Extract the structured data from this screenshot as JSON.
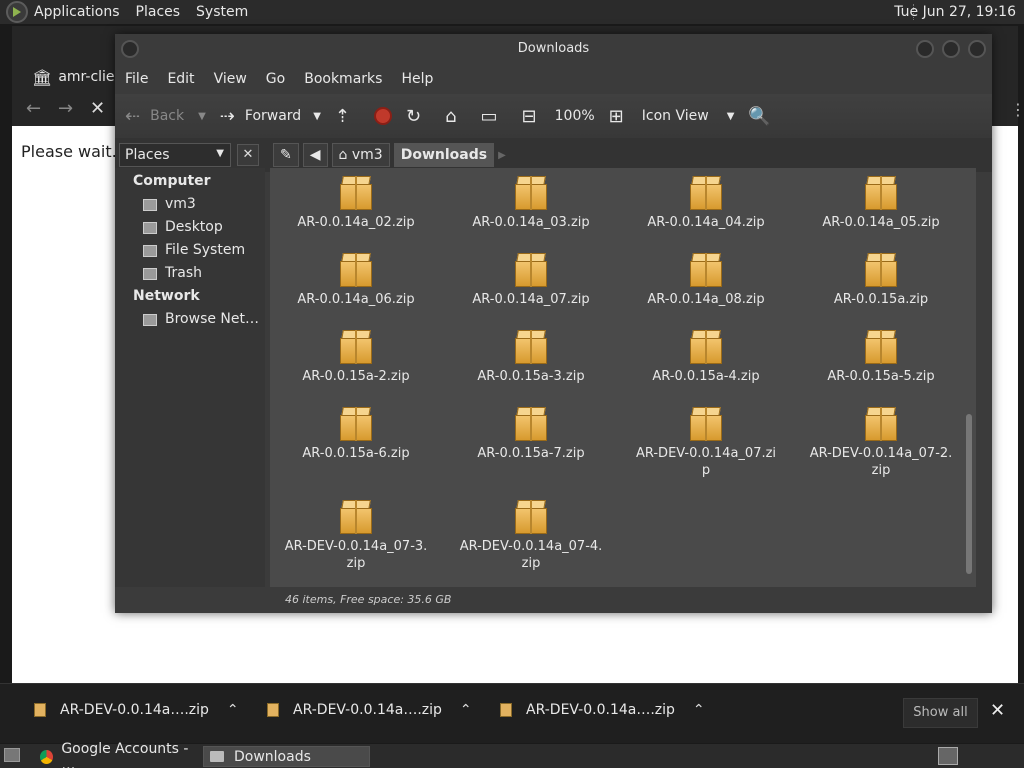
{
  "top_panel": {
    "menus": [
      "Applications",
      "Places",
      "System"
    ],
    "clock": "Tue Jun 27, 19:16"
  },
  "browser": {
    "tab_label": "amr-clien",
    "page_text": "Please wait..."
  },
  "fm": {
    "title": "Downloads",
    "menu": [
      "File",
      "Edit",
      "View",
      "Go",
      "Bookmarks",
      "Help"
    ],
    "toolbar": {
      "back": "Back",
      "forward": "Forward",
      "zoom": "100%",
      "view_mode": "Icon View"
    },
    "locbar": {
      "places": "Places",
      "crumbs": [
        "vm3",
        "Downloads"
      ]
    },
    "sidebar": {
      "computer": "Computer",
      "computer_items": [
        "vm3",
        "Desktop",
        "File System",
        "Trash"
      ],
      "network": "Network",
      "network_items": [
        "Browse Net…"
      ]
    },
    "files": [
      "AR-0.0.14a_02.zip",
      "AR-0.0.14a_03.zip",
      "AR-0.0.14a_04.zip",
      "AR-0.0.14a_05.zip",
      "AR-0.0.14a_06.zip",
      "AR-0.0.14a_07.zip",
      "AR-0.0.14a_08.zip",
      "AR-0.0.15a.zip",
      "AR-0.0.15a-2.zip",
      "AR-0.0.15a-3.zip",
      "AR-0.0.15a-4.zip",
      "AR-0.0.15a-5.zip",
      "AR-0.0.15a-6.zip",
      "AR-0.0.15a-7.zip",
      "AR-DEV-0.0.14a_07.zip",
      "AR-DEV-0.0.14a_07-2.zip",
      "AR-DEV-0.0.14a_07-3.zip",
      "AR-DEV-0.0.14a_07-4.zip"
    ],
    "status": "46 items, Free space: 35.6 GB"
  },
  "shelf": {
    "downloads": [
      "AR-DEV-0.0.14a….zip",
      "AR-DEV-0.0.14a….zip",
      "AR-DEV-0.0.14a….zip"
    ],
    "show_all": "Show all"
  },
  "taskbar": {
    "tasks": [
      "Google Accounts - …",
      "Downloads"
    ]
  }
}
